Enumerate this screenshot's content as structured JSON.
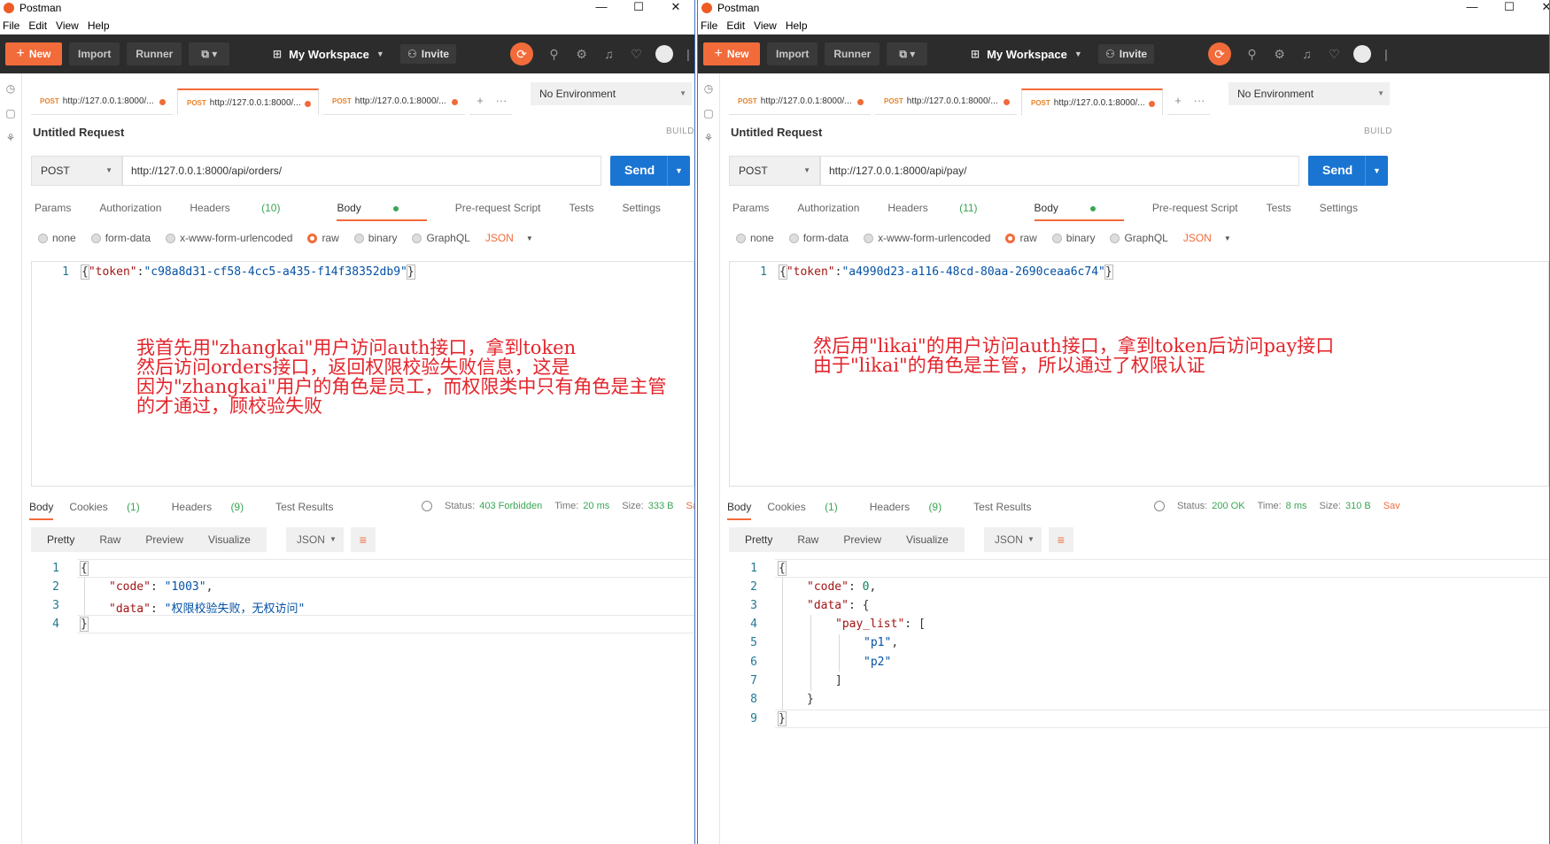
{
  "left": {
    "window_title": "Postman",
    "menu": [
      "File",
      "Edit",
      "View",
      "Help"
    ],
    "header": {
      "new": "New",
      "import": "Import",
      "runner": "Runner",
      "workspace": "My Workspace",
      "invite": "Invite"
    },
    "tabs": [
      {
        "method": "POST",
        "url": "http://127.0.0.1:8000/..."
      },
      {
        "method": "POST",
        "url": "http://127.0.0.1:8000/..."
      },
      {
        "method": "POST",
        "url": "http://127.0.0.1:8000/..."
      }
    ],
    "environment": "No Environment",
    "request_name": "Untitled Request",
    "build": "BUILD",
    "method": "POST",
    "url": "http://127.0.0.1:8000/api/orders/",
    "send": "Send",
    "req_tabs": {
      "params": "Params",
      "authorization": "Authorization",
      "headers": "Headers",
      "headers_count": "(10)",
      "body": "Body",
      "prerequest": "Pre-request Script",
      "tests": "Tests",
      "settings": "Settings"
    },
    "body_opts": {
      "none": "none",
      "form_data": "form-data",
      "urlencoded": "x-www-form-urlencoded",
      "raw": "raw",
      "binary": "binary",
      "graphql": "GraphQL",
      "json": "JSON"
    },
    "request_body": {
      "line": "1",
      "key": "\"token\"",
      "colon": ":",
      "value": "\"c98a8d31-cf58-4cc5-a435-f14f38352db9\"",
      "open": "{",
      "close": "}"
    },
    "annotation": [
      "我首先用\"zhangkai\"用户访问auth接口，拿到token",
      "然后访问orders接口，返回权限校验失败信息，这是",
      "因为\"zhangkai\"用户的角色是员工，而权限类中只有角色是主管",
      "的才通过，顾校验失败"
    ],
    "resp_tabs": {
      "body": "Body",
      "cookies": "Cookies",
      "cookies_count": "(1)",
      "headers": "Headers",
      "headers_count": "(9)",
      "test_results": "Test Results"
    },
    "status": {
      "status_label": "Status:",
      "status_value": "403 Forbidden",
      "time_label": "Time:",
      "time_value": "20 ms",
      "size_label": "Size:",
      "size_value": "333 B",
      "save": "Save"
    },
    "views": {
      "pretty": "Pretty",
      "raw": "Raw",
      "preview": "Preview",
      "visualize": "Visualize",
      "format": "JSON"
    },
    "response": {
      "lines": [
        "1",
        "2",
        "3",
        "4"
      ],
      "open": "{",
      "close": "}",
      "code_key": "\"code\"",
      "code_val": "\"1003\"",
      "data_key": "\"data\"",
      "data_val": "\"权限校验失败，无权访问\""
    }
  },
  "right": {
    "window_title": "Postman",
    "menu": [
      "File",
      "Edit",
      "View",
      "Help"
    ],
    "header": {
      "new": "New",
      "import": "Import",
      "runner": "Runner",
      "workspace": "My Workspace",
      "invite": "Invite"
    },
    "tabs": [
      {
        "method": "POST",
        "url": "http://127.0.0.1:8000/..."
      },
      {
        "method": "POST",
        "url": "http://127.0.0.1:8000/..."
      },
      {
        "method": "POST",
        "url": "http://127.0.0.1:8000/..."
      }
    ],
    "environment": "No Environment",
    "request_name": "Untitled Request",
    "build": "BUILD",
    "method": "POST",
    "url": "http://127.0.0.1:8000/api/pay/",
    "send": "Send",
    "req_tabs": {
      "params": "Params",
      "authorization": "Authorization",
      "headers": "Headers",
      "headers_count": "(11)",
      "body": "Body",
      "prerequest": "Pre-request Script",
      "tests": "Tests",
      "settings": "Settings"
    },
    "body_opts": {
      "none": "none",
      "form_data": "form-data",
      "urlencoded": "x-www-form-urlencoded",
      "raw": "raw",
      "binary": "binary",
      "graphql": "GraphQL",
      "json": "JSON"
    },
    "request_body": {
      "line": "1",
      "key": "\"token\"",
      "colon": ":",
      "value": "\"a4990d23-a116-48cd-80aa-2690ceaa6c74\"",
      "open": "{",
      "close": "}"
    },
    "annotation": [
      "然后用\"likai\"的用户访问auth接口，拿到token后访问pay接口",
      "由于\"likai\"的角色是主管，所以通过了权限认证"
    ],
    "resp_tabs": {
      "body": "Body",
      "cookies": "Cookies",
      "cookies_count": "(1)",
      "headers": "Headers",
      "headers_count": "(9)",
      "test_results": "Test Results"
    },
    "status": {
      "status_label": "Status:",
      "status_value": "200 OK",
      "time_label": "Time:",
      "time_value": "8 ms",
      "size_label": "Size:",
      "size_value": "310 B",
      "save": "Sav"
    },
    "views": {
      "pretty": "Pretty",
      "raw": "Raw",
      "preview": "Preview",
      "visualize": "Visualize",
      "format": "JSON"
    },
    "response": {
      "lines": [
        "1",
        "2",
        "3",
        "4",
        "5",
        "6",
        "7",
        "8",
        "9"
      ],
      "open": "{",
      "close": "}",
      "code_key": "\"code\"",
      "code_val": "0",
      "data_key": "\"data\"",
      "data_open": "{",
      "pay_list_key": "\"pay_list\"",
      "list_open": "[",
      "p1": "\"p1\"",
      "p2": "\"p2\"",
      "list_close": "]",
      "data_close": "}"
    }
  },
  "colors": {
    "accent": "#f26b3a",
    "send": "#1a75d2",
    "header": "#2c2c2c",
    "annotation": "#e3242b",
    "ok": "#3aa655"
  }
}
